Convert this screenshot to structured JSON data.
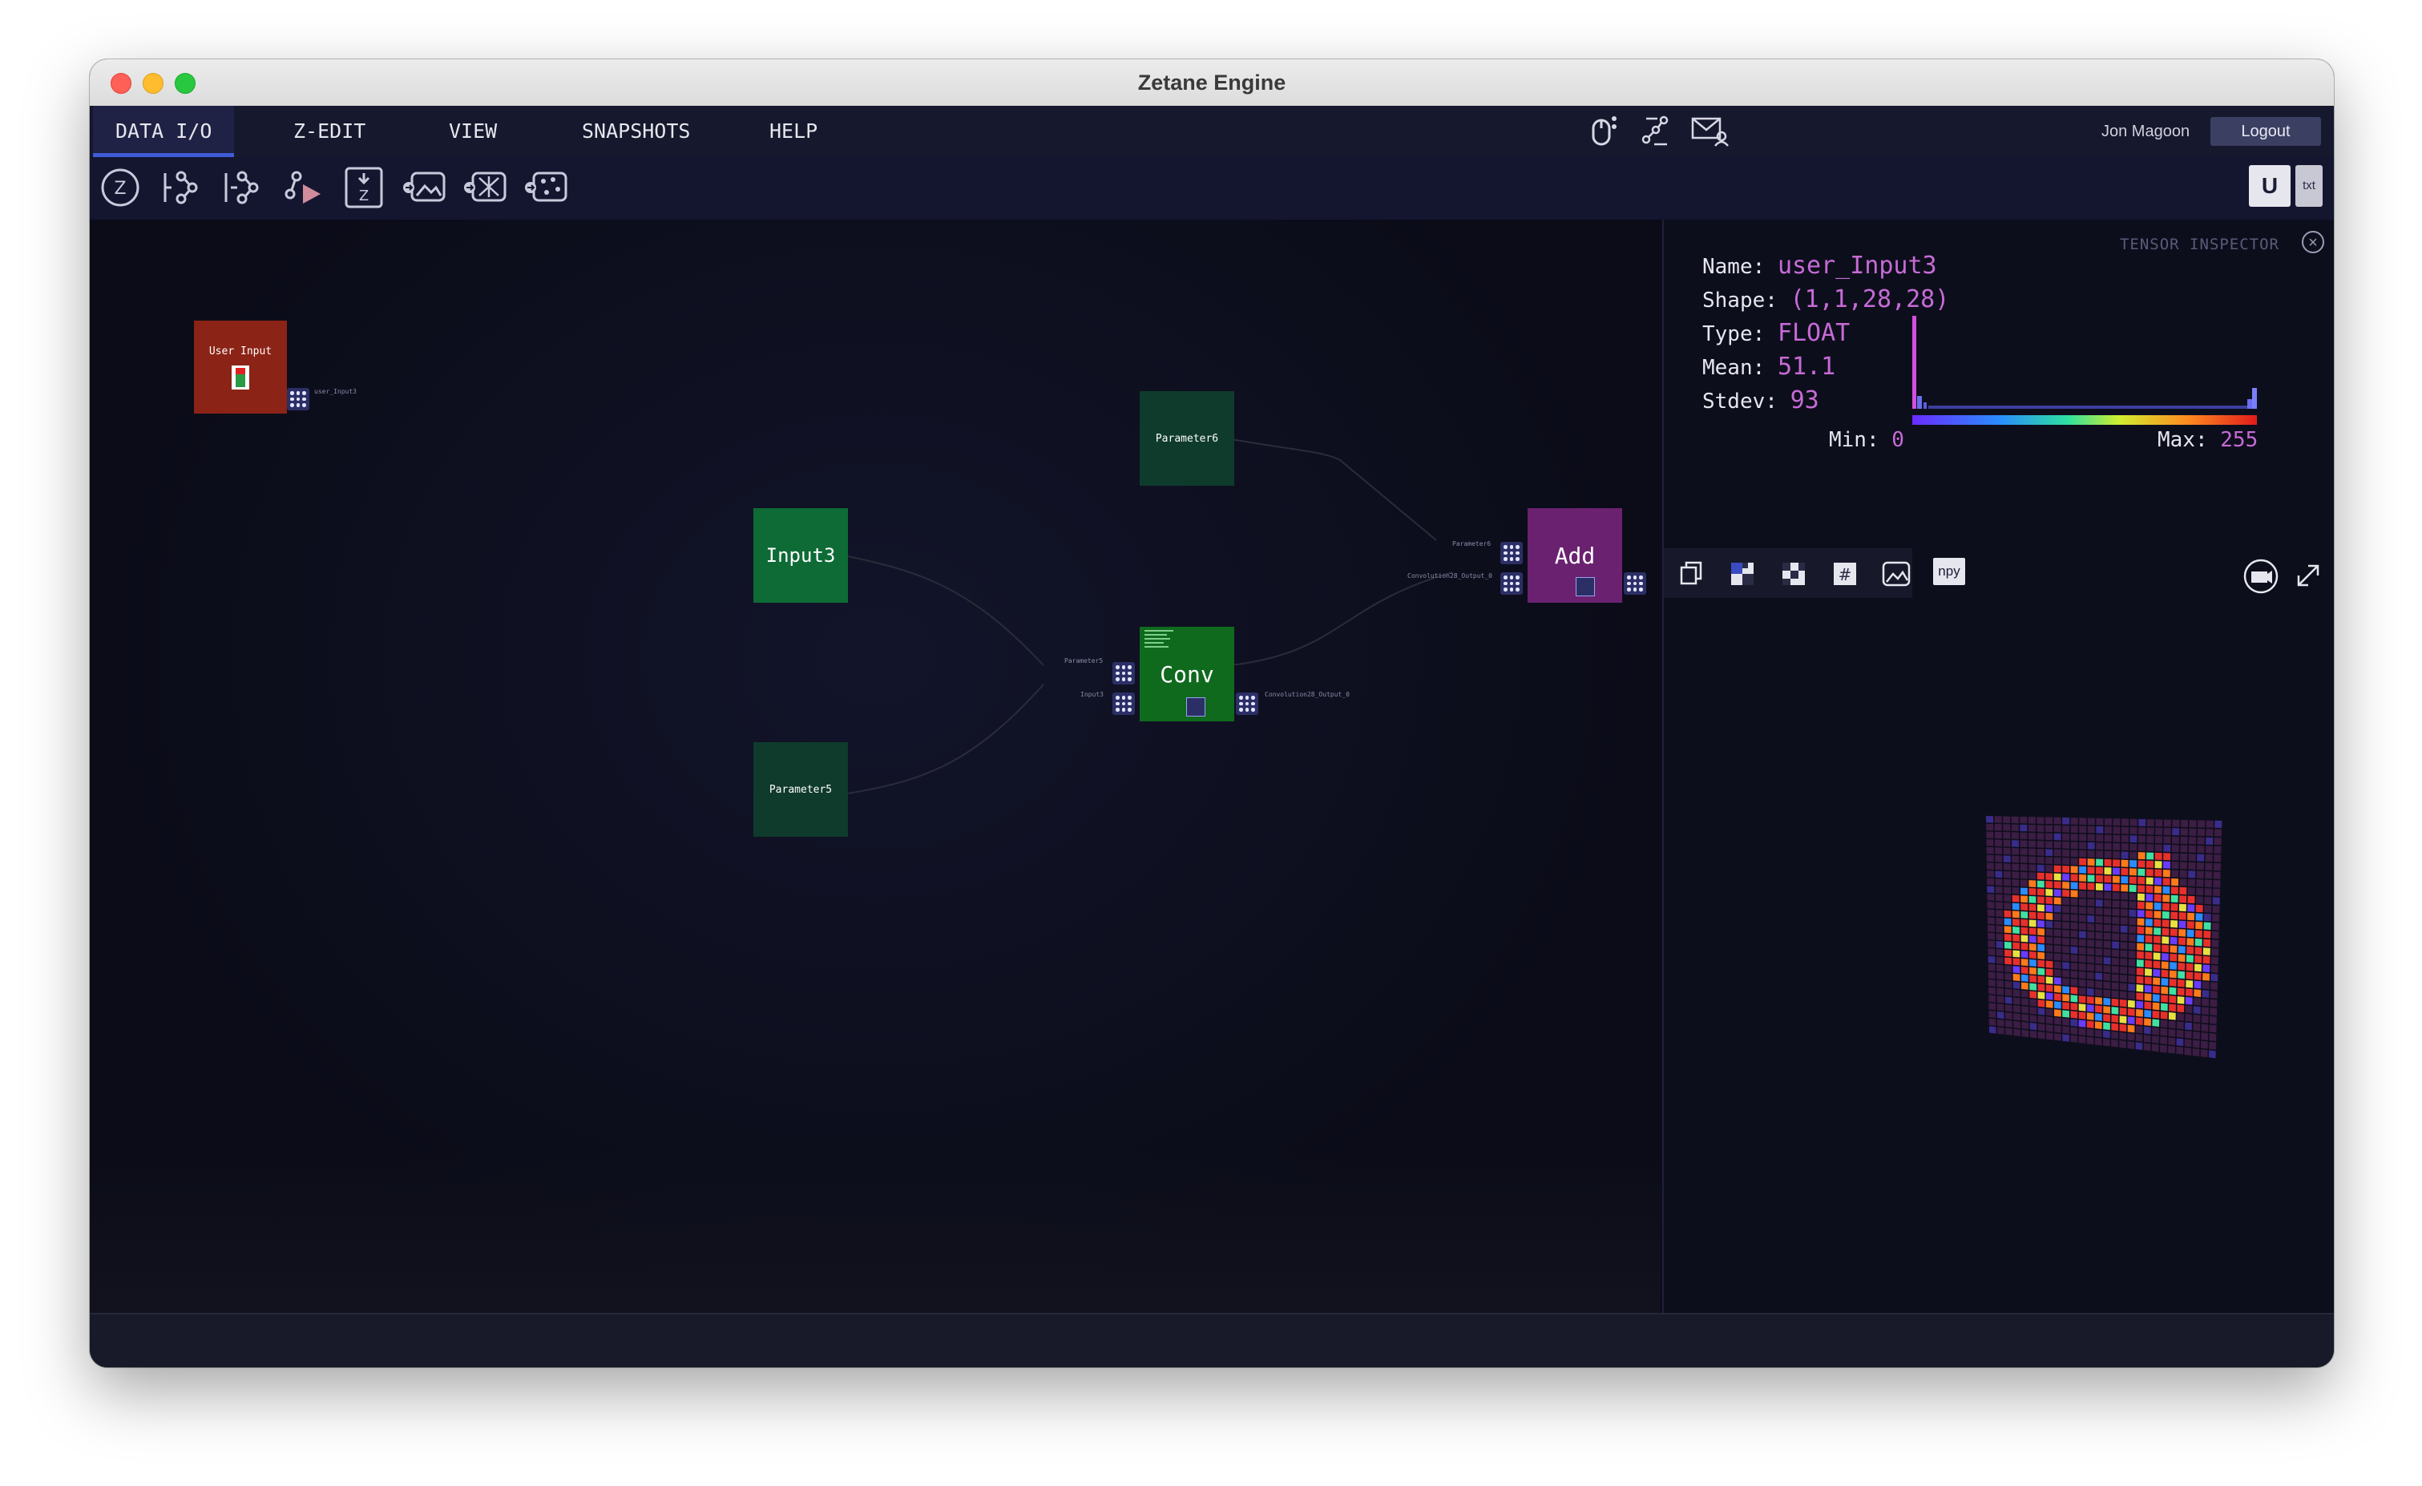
{
  "window": {
    "title": "Zetane Engine"
  },
  "menu": {
    "items": [
      "DATA I/O",
      "Z-EDIT",
      "VIEW",
      "SNAPSHOTS",
      "HELP"
    ],
    "active": "DATA I/O",
    "user": "Jon Magoon",
    "logout": "Logout"
  },
  "toolbar": {
    "u_label": "U",
    "txt_label": "txt",
    "icons": [
      "zetane-logo-icon",
      "graph-in-icon",
      "graph-out-icon",
      "graph-run-icon",
      "z-download-icon",
      "load-image-icon",
      "load-model-icon",
      "load-dataset-icon"
    ]
  },
  "graph": {
    "nodes": {
      "user_input": {
        "label": "User Input",
        "port_label": "user_Input3"
      },
      "input3": {
        "label": "Input3"
      },
      "parameter6": {
        "label": "Parameter6"
      },
      "parameter5": {
        "label": "Parameter5"
      },
      "conv": {
        "label": "Conv",
        "in_port_1": "Parameter5",
        "in_port_2": "Input3",
        "out_port": "Convolution28_Output_0"
      },
      "add": {
        "label": "Add",
        "in_port_1": "Parameter6",
        "in_port_2": "Convolution28_Output_0"
      }
    },
    "colors": {
      "user_input": "#8b2316",
      "input3": "#0e6b36",
      "parameter": "#0f3b2c",
      "conv": "#0f6a1d",
      "add": "#6a2270"
    }
  },
  "inspector": {
    "title": "TENSOR INSPECTOR",
    "name_label": "Name:",
    "name": "user_Input3",
    "shape_label": "Shape:",
    "shape": "(1,1,28,28)",
    "type_label": "Type:",
    "type": "FLOAT",
    "mean_label": "Mean:",
    "mean": "51.1",
    "stdev_label": "Stdev:",
    "stdev": "93",
    "min_label": "Min:",
    "min": "0",
    "max_label": "Max:",
    "max": "255",
    "npy_label": "npy",
    "tool_icons": [
      "copy-icon",
      "checker-color-icon",
      "checker-bw-icon",
      "hash-icon",
      "image-icon"
    ]
  }
}
